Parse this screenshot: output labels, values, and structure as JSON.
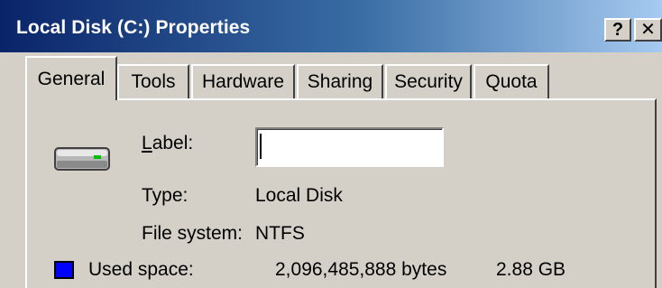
{
  "window": {
    "title": "Local Disk (C:) Properties",
    "help_label": "?",
    "close_label": "✕"
  },
  "tabs": [
    {
      "label": "General",
      "active": true
    },
    {
      "label": "Tools"
    },
    {
      "label": "Hardware"
    },
    {
      "label": "Sharing"
    },
    {
      "label": "Security"
    },
    {
      "label": "Quota"
    }
  ],
  "general": {
    "drive_icon": "hard-drive-icon",
    "label_field": {
      "label_accel": "L",
      "label_rest": "abel:",
      "value": ""
    },
    "type_label": "Type:",
    "type_value": "Local Disk",
    "fs_label": "File system:",
    "fs_value": "NTFS",
    "used_space": {
      "label": "Used space:",
      "bytes": "2,096,485,888 bytes",
      "size": "2.88 GB",
      "color": "#0000ff"
    }
  }
}
